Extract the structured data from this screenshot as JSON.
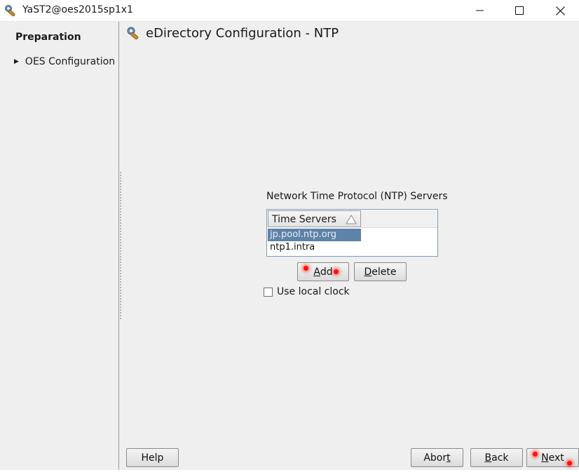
{
  "window": {
    "title": "YaST2@oes2015sp1x1",
    "controls": [
      "minimize-icon",
      "maximize-icon",
      "close-icon"
    ]
  },
  "sidebar": {
    "heading": "Preparation",
    "items": [
      {
        "label": "OES Configuration",
        "icon": "triangle-right-icon"
      }
    ]
  },
  "main": {
    "title": "eDirectory Configuration - NTP",
    "section_label": "Network Time Protocol (NTP) Servers",
    "table": {
      "column_header": "Time Servers",
      "rows": [
        "jp.pool.ntp.org",
        "ntp1.intra"
      ],
      "selected_row": "jp.pool.ntp.org"
    },
    "add_button": {
      "mnemonic": "A",
      "rest": "dd"
    },
    "delete_button": {
      "mnemonic": "D",
      "rest": "elete"
    },
    "use_local_clock": {
      "mnemonic": "U",
      "rest": "se local clock",
      "checked": false
    }
  },
  "footer": {
    "help": "Help",
    "abort": {
      "pre": "Abor",
      "mnemonic": "t"
    },
    "back": {
      "mnemonic": "B",
      "rest": "ack"
    },
    "next": {
      "mnemonic": "N",
      "rest": "ext"
    }
  },
  "colors": {
    "selection": "#5e82a8",
    "click_marker": "#ff1010"
  }
}
